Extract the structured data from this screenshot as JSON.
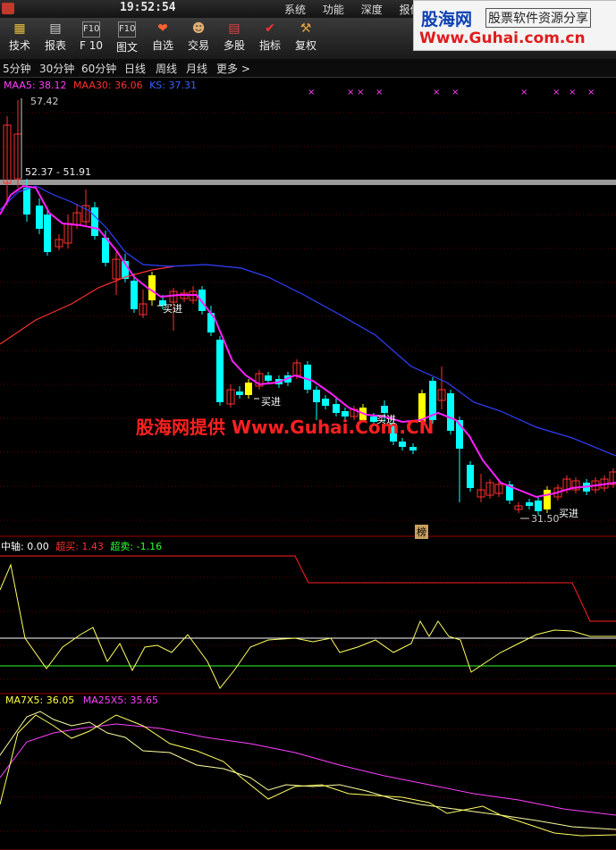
{
  "topbar": {
    "time": "19:52:54",
    "menu": [
      "系统",
      "功能",
      "深度",
      "报价"
    ]
  },
  "watermark": {
    "brand": "股海网",
    "tagline": "股票软件资源分享",
    "url": "Www.Guhai.com.cn"
  },
  "toolbar": [
    {
      "label": "技术",
      "icon": "chart-icon"
    },
    {
      "label": "报表",
      "icon": "table-icon"
    },
    {
      "label": "F 10",
      "icon": "f10-icon"
    },
    {
      "label": "图文",
      "icon": "f10-icon"
    },
    {
      "label": "自选",
      "icon": "star-icon"
    },
    {
      "label": "交易",
      "icon": "trade-icon"
    },
    {
      "label": "多股",
      "icon": "grid-icon"
    },
    {
      "label": "指标",
      "icon": "check-icon"
    },
    {
      "label": "复权",
      "icon": "hammer-icon"
    }
  ],
  "periods": [
    "5分钟",
    "30分钟",
    "60分钟",
    "日线",
    "周线",
    "月线",
    "更多 >"
  ],
  "main_panel": {
    "legend": [
      {
        "text": "MAA5: 38.12",
        "color": "#ff00ff"
      },
      {
        "text": "MAA30: 36.06",
        "color": "#ff3030"
      },
      {
        "text": "KS: 37.31",
        "color": "#3050ff"
      }
    ],
    "high_label": "57.42",
    "range_label": "52.37 - 51.91",
    "low_label": "31.50",
    "buy_label": "买进",
    "badge": "榜"
  },
  "overlay_text": "股海网提供 Www.Guhai.Com.CN",
  "panel2": {
    "legend": [
      {
        "text": "中轴: 0.00",
        "color": "#ffffff"
      },
      {
        "text": "超买: 1.43",
        "color": "#ff3030"
      },
      {
        "text": "超卖: -1.16",
        "color": "#30ff30"
      }
    ]
  },
  "panel3": {
    "legend": [
      {
        "text": "MA7X5: 36.05",
        "color": "#ffff40"
      },
      {
        "text": "MA25X5: 35.65",
        "color": "#ff40ff"
      }
    ]
  },
  "chart_data": {
    "type": "candlestick",
    "series": [
      {
        "name": "MAA5",
        "color": "#ff00ff"
      },
      {
        "name": "MAA30",
        "color": "#ff3030"
      },
      {
        "name": "KS",
        "color": "#3050ff"
      }
    ],
    "annotations": {
      "max": 57.42,
      "min": 31.5,
      "band": [
        52.37,
        51.91
      ]
    }
  },
  "colors": {
    "up": "#ff3030",
    "down": "#00ffff",
    "buy": "#ffff00",
    "grid": "#600000"
  }
}
